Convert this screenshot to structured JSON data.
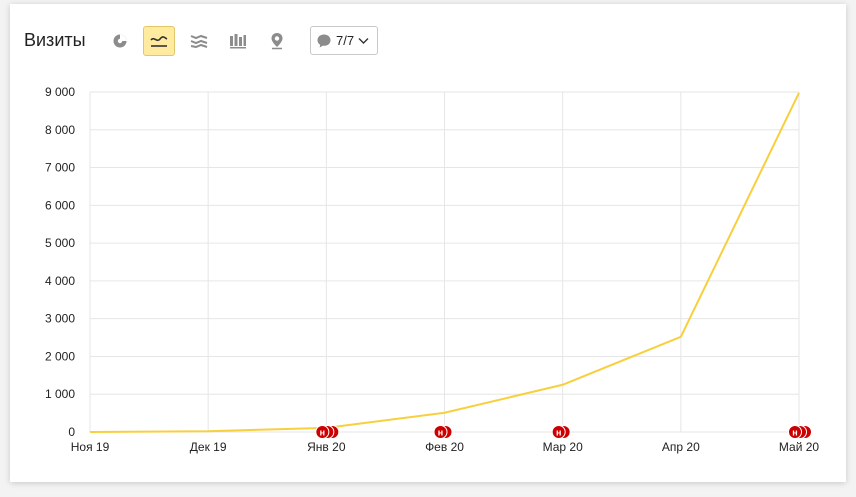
{
  "header": {
    "title": "Визиты",
    "comments_count": "7/7"
  },
  "toolbar": {
    "tools": [
      {
        "icon": "pie-chart-icon",
        "active": false
      },
      {
        "icon": "line-chart-icon",
        "active": true
      },
      {
        "icon": "stacked-area-icon",
        "active": false
      },
      {
        "icon": "bar-chart-icon",
        "active": false
      },
      {
        "icon": "map-pin-icon",
        "active": false
      }
    ]
  },
  "colors": {
    "line": "#f8cf3c",
    "grid": "#e6e6e6",
    "marker": "#cc0000",
    "active_tool_bg": "#ffeba0"
  },
  "chart_data": {
    "type": "line",
    "categories": [
      "Ноя 19",
      "Дек 19",
      "Янв 20",
      "Фев 20",
      "Мар 20",
      "Апр 20",
      "Май 20"
    ],
    "series": [
      {
        "values": [
          0,
          20,
          110,
          510,
          1250,
          2520,
          8980
        ]
      }
    ],
    "ylim": [
      0,
      9000
    ],
    "yticks": [
      0,
      1000,
      2000,
      3000,
      4000,
      5000,
      6000,
      7000,
      8000,
      9000
    ],
    "ytick_labels": [
      "0",
      "1 000",
      "2 000",
      "3 000",
      "4 000",
      "5 000",
      "6 000",
      "7 000",
      "8 000",
      "9 000"
    ],
    "grid": true,
    "annotations": [
      {
        "category": "Янв 20",
        "label": "н",
        "count": 3
      },
      {
        "category": "Фев 20",
        "label": "н",
        "count": 2
      },
      {
        "category": "Мар 20",
        "label": "н",
        "count": 2
      },
      {
        "category": "Май 20",
        "label": "н",
        "count": 3
      }
    ]
  }
}
